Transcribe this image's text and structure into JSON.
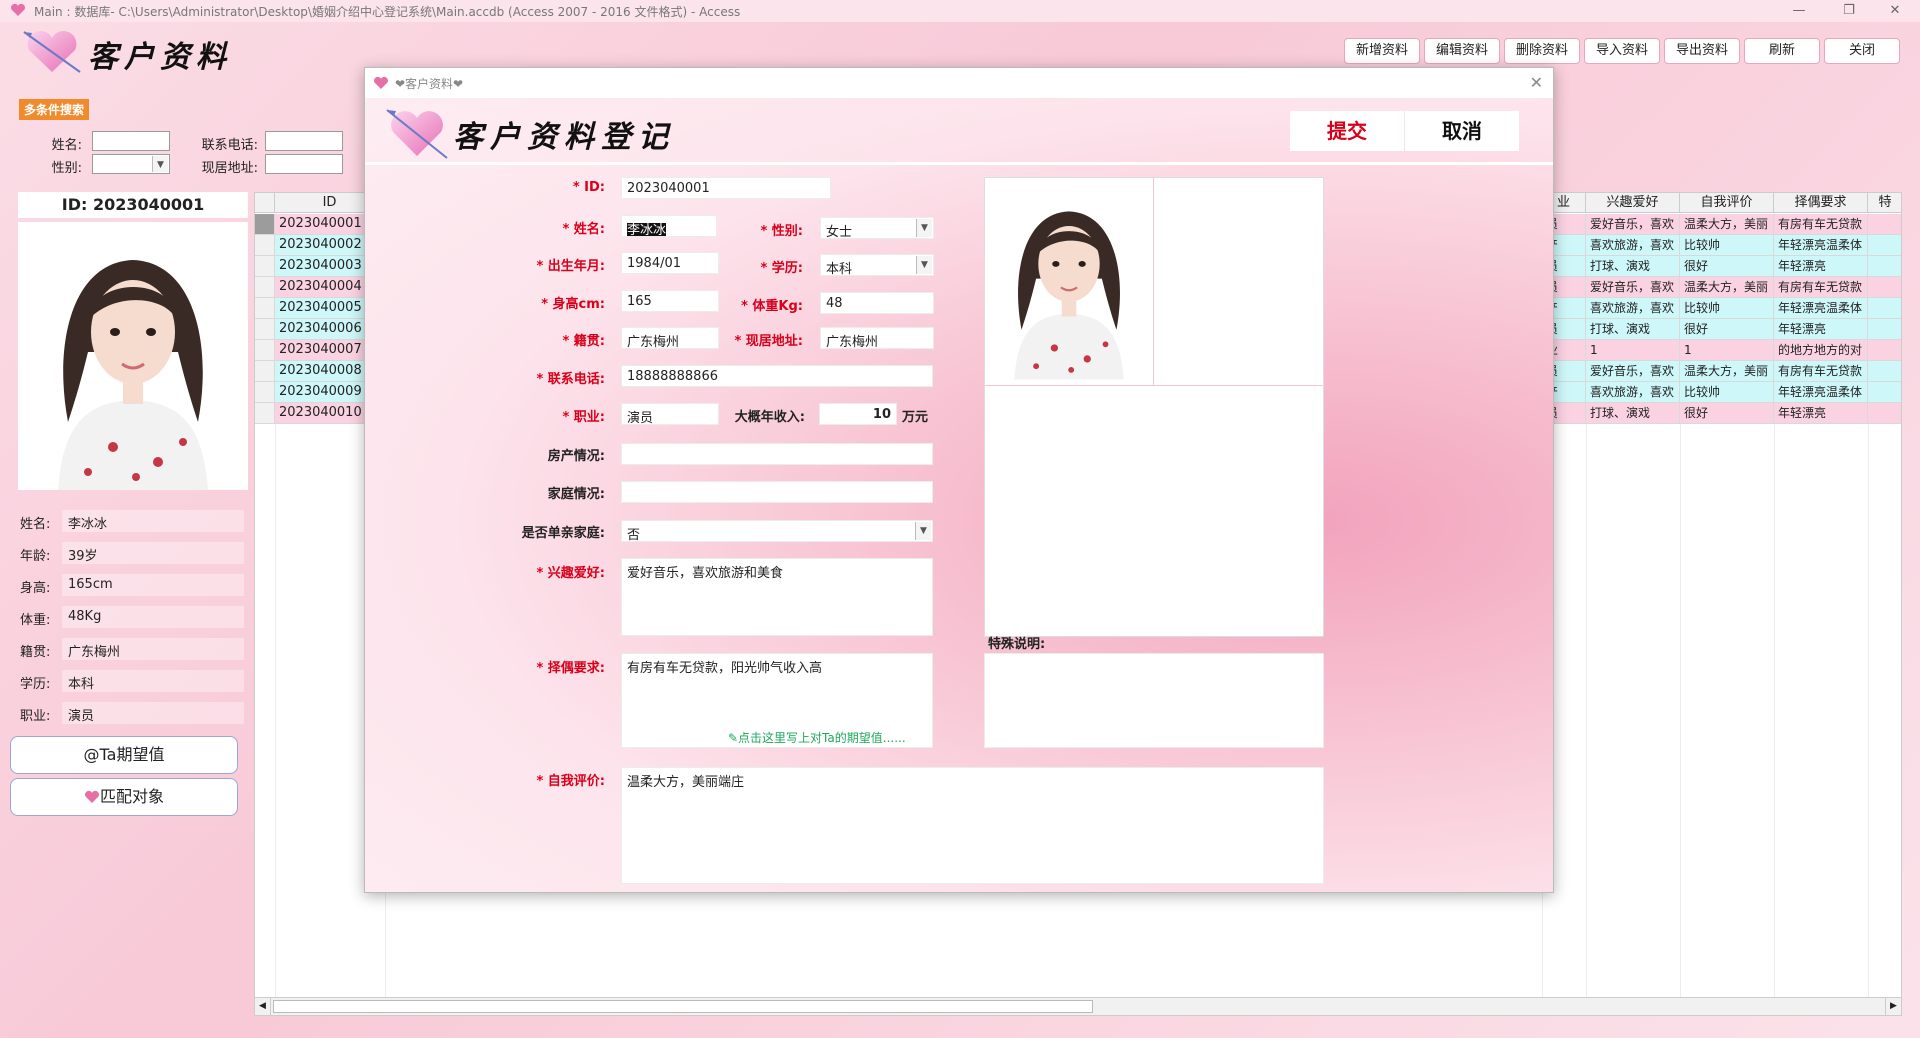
{
  "titlebar": {
    "text": "Main : 数据库- C:\\Users\\Administrator\\Desktop\\婚姻介绍中心登记系统\\Main.accdb (Access 2007 - 2016 文件格式) - Access",
    "minimize": "—",
    "restore": "❐",
    "close": "✕"
  },
  "header": {
    "title": "客户资料"
  },
  "toolbar": {
    "buttons": [
      "新增资料",
      "编辑资料",
      "删除资料",
      "导入资料",
      "导出资料",
      "刷新",
      "关闭"
    ]
  },
  "search": {
    "badge": "多条件搜索",
    "name_label": "姓名:",
    "phone_label": "联系电话:",
    "gender_label": "性别:",
    "address_label": "现居地址:",
    "name_value": "",
    "phone_value": "",
    "gender_value": "",
    "address_value": ""
  },
  "left_panel": {
    "id_text": "ID:  2023040001",
    "rows": [
      {
        "label": "姓名:",
        "value": "李冰冰"
      },
      {
        "label": "年龄:",
        "value": "39岁"
      },
      {
        "label": "身高:",
        "value": "165cm"
      },
      {
        "label": "体重:",
        "value": "48Kg"
      },
      {
        "label": "籍贯:",
        "value": "广东梅州"
      },
      {
        "label": "学历:",
        "value": "本科"
      },
      {
        "label": "职业:",
        "value": "演员"
      }
    ],
    "btn_expect": "@Ta期望值",
    "btn_match": "匹配对象"
  },
  "grid": {
    "id_header": "ID",
    "right_headers": [
      "业",
      "兴趣爱好",
      "自我评价",
      "择偶要求",
      "特"
    ],
    "ids": [
      "2023040001",
      "2023040002",
      "2023040003",
      "2023040004",
      "2023040005",
      "2023040006",
      "2023040007",
      "2023040008",
      "2023040009",
      "2023040010"
    ],
    "right_rows": [
      [
        "员",
        "爱好音乐，喜欢",
        "温柔大方，美丽",
        "有房有车无贷款"
      ],
      [
        "产",
        "喜欢旅游，喜欢",
        "比较帅",
        "年轻漂亮温柔体"
      ],
      [
        "员",
        "打球、演戏",
        "很好",
        "年轻漂亮"
      ],
      [
        "员",
        "爱好音乐，喜欢",
        "温柔大方，美丽",
        "有房有车无贷款"
      ],
      [
        "产",
        "喜欢旅游，喜欢",
        "比较帅",
        "年轻漂亮温柔体"
      ],
      [
        "员",
        "打球、演戏",
        "很好",
        "年轻漂亮"
      ],
      [
        "业",
        "1",
        "1",
        "的地方地方的对"
      ],
      [
        "员",
        "爱好音乐，喜欢",
        "温柔大方，美丽",
        "有房有车无贷款"
      ],
      [
        "产",
        "喜欢旅游，喜欢",
        "比较帅",
        "年轻漂亮温柔体"
      ],
      [
        "员",
        "打球、演戏",
        "很好",
        "年轻漂亮"
      ]
    ],
    "row_colors": [
      "#fbd2e2",
      "#cdf7f9",
      "#cdf7f9"
    ]
  },
  "dialog": {
    "window_title": "❤客户资料❤",
    "heading": "客户资料登记",
    "submit": "提交",
    "cancel": "取消",
    "fields": {
      "id_label": "* ID:",
      "id": "2023040001",
      "name_label": "* 姓名:",
      "name": "李冰冰",
      "gender_label": "* 性别:",
      "gender": "女士",
      "birth_label": "* 出生年月:",
      "birth": "1984/01",
      "edu_label": "* 学历:",
      "edu": "本科",
      "height_label": "* 身高cm:",
      "height": "165",
      "weight_label": "* 体重Kg:",
      "weight": "48",
      "native_label": "* 籍贯:",
      "native": "广东梅州",
      "addr_label": "* 现居地址:",
      "addr": "广东梅州",
      "phone_label": "* 联系电话:",
      "phone": "18888888866",
      "job_label": "* 职业:",
      "job": "演员",
      "income_label": "大概年收入:",
      "income": "10",
      "income_unit": "万元",
      "house_label": "房产情况:",
      "house": "",
      "family_label": "家庭情况:",
      "family": "",
      "single_label": "是否单亲家庭:",
      "single": "否",
      "hobby_label": "* 兴趣爱好:",
      "hobby": "爱好音乐，喜欢旅游和美食",
      "mate_label": "* 择偶要求:",
      "mate": "有房有车无贷款，阳光帅气收入高",
      "mate_hint": "✎点击这里写上对Ta的期望值......",
      "self_label": "* 自我评价:",
      "self": "温柔大方，美丽端庄",
      "special_label": "特殊说明:",
      "special": ""
    }
  },
  "colors": {
    "accent": "#d9001b",
    "badge": "#f08a2b",
    "pink": "#f7c1d1"
  }
}
